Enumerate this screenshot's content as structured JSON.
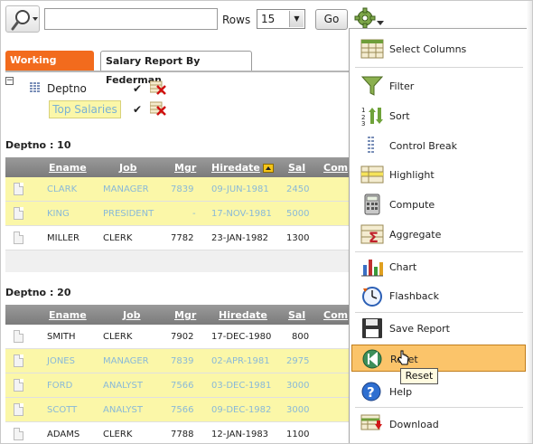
{
  "toolbar": {
    "search_value": "",
    "rows_label": "Rows",
    "rows_value": "15",
    "go_label": "Go"
  },
  "tabs": [
    {
      "label": "Working Report",
      "active": true
    },
    {
      "label": "Salary Report By Federman",
      "active": false
    }
  ],
  "filters": {
    "control_break": "Deptno",
    "highlight": "Top Salaries"
  },
  "groups": [
    {
      "title": "Deptno : 10",
      "columns": [
        "Ename",
        "Job",
        "Mgr",
        "Hiredate",
        "Sal",
        "Com"
      ],
      "rows": [
        {
          "ename": "CLARK",
          "job": "MANAGER",
          "mgr": "7839",
          "hiredate": "09-JUN-1981",
          "sal": "2450",
          "highlight": true
        },
        {
          "ename": "KING",
          "job": "PRESIDENT",
          "mgr": "-",
          "hiredate": "17-NOV-1981",
          "sal": "5000",
          "highlight": true
        },
        {
          "ename": "MILLER",
          "job": "CLERK",
          "mgr": "7782",
          "hiredate": "23-JAN-1982",
          "sal": "1300",
          "highlight": false
        }
      ]
    },
    {
      "title": "Deptno : 20",
      "columns": [
        "Ename",
        "Job",
        "Mgr",
        "Hiredate",
        "Sal",
        "Com"
      ],
      "rows": [
        {
          "ename": "SMITH",
          "job": "CLERK",
          "mgr": "7902",
          "hiredate": "17-DEC-1980",
          "sal": "800",
          "highlight": false
        },
        {
          "ename": "JONES",
          "job": "MANAGER",
          "mgr": "7839",
          "hiredate": "02-APR-1981",
          "sal": "2975",
          "highlight": true
        },
        {
          "ename": "FORD",
          "job": "ANALYST",
          "mgr": "7566",
          "hiredate": "03-DEC-1981",
          "sal": "3000",
          "highlight": true
        },
        {
          "ename": "SCOTT",
          "job": "ANALYST",
          "mgr": "7566",
          "hiredate": "09-DEC-1982",
          "sal": "3000",
          "highlight": true
        },
        {
          "ename": "ADAMS",
          "job": "CLERK",
          "mgr": "7788",
          "hiredate": "12-JAN-1983",
          "sal": "1100",
          "highlight": false
        }
      ]
    }
  ],
  "menu": {
    "items": [
      {
        "label": "Select Columns",
        "icon": "select-columns-icon"
      },
      {
        "label": "Filter",
        "icon": "filter-funnel-icon"
      },
      {
        "label": "Sort",
        "icon": "sort-icon"
      },
      {
        "label": "Control Break",
        "icon": "control-break-icon"
      },
      {
        "label": "Highlight",
        "icon": "highlight-icon"
      },
      {
        "label": "Compute",
        "icon": "calculator-icon"
      },
      {
        "label": "Aggregate",
        "icon": "sigma-icon"
      },
      {
        "label": "Chart",
        "icon": "bar-chart-icon"
      },
      {
        "label": "Flashback",
        "icon": "clock-icon"
      },
      {
        "label": "Save Report",
        "icon": "floppy-disk-icon"
      },
      {
        "label": "Reset",
        "icon": "reset-rewind-icon"
      },
      {
        "label": "Help",
        "icon": "help-icon"
      },
      {
        "label": "Download",
        "icon": "download-icon"
      }
    ],
    "hovered": "Reset",
    "tooltip": "Reset"
  },
  "colors": {
    "active_tab": "#f26b1d",
    "highlight_row": "#fbf7a8",
    "highlight_text": "#89b9d8",
    "menu_hover": "#fbc46a"
  }
}
